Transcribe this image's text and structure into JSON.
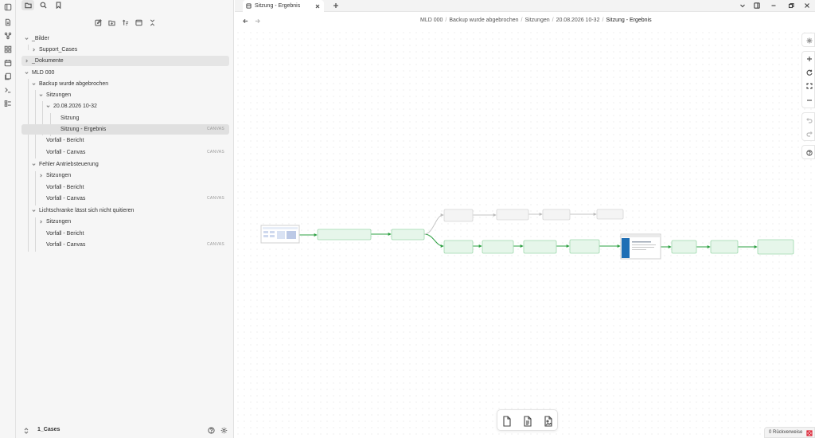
{
  "sidebar": {
    "tree": [
      {
        "label": "_Bilder",
        "badge": ""
      },
      {
        "label": "Support_Cases",
        "badge": ""
      },
      {
        "label": "_Dokumente",
        "badge": ""
      },
      {
        "label": "MLD 000",
        "badge": ""
      },
      {
        "label": "Backup wurde abgebrochen",
        "badge": ""
      },
      {
        "label": "Sitzungen",
        "badge": ""
      },
      {
        "label": "20.08.2026 10-32",
        "badge": ""
      },
      {
        "label": "Sitzung",
        "badge": ""
      },
      {
        "label": "Sitzung - Ergebnis",
        "badge": "CANVAS"
      },
      {
        "label": "Vorfall - Bericht",
        "badge": ""
      },
      {
        "label": "Vorfall - Canvas",
        "badge": "CANVAS"
      },
      {
        "label": "Fehler Antriebsteuerung",
        "badge": ""
      },
      {
        "label": "Sitzungen",
        "badge": ""
      },
      {
        "label": "Vorfall - Bericht",
        "badge": ""
      },
      {
        "label": "Vorfall - Canvas",
        "badge": "CANVAS"
      },
      {
        "label": "Lichtschranke lässt sich nicht quitieren",
        "badge": ""
      },
      {
        "label": "Sitzungen",
        "badge": ""
      },
      {
        "label": "Vorfall - Bericht",
        "badge": ""
      },
      {
        "label": "Vorfall - Canvas",
        "badge": "CANVAS"
      }
    ],
    "vault_name": "1_Cases"
  },
  "tab": {
    "title": "Sitzung - Ergebnis"
  },
  "breadcrumb": [
    "MLD 000",
    "Backup wurde abgebrochen",
    "Sitzungen",
    "20.08.2026 10-32",
    "Sitzung - Ergebnis"
  ],
  "status": {
    "backlinks": "0 Rückverweise"
  },
  "colors": {
    "accent_green": "#2ea043",
    "node_fill": "#e6f6ea",
    "node_border": "#9fd9ad",
    "muted_node": "#f4f4f4",
    "muted_border": "#d6d6d6"
  }
}
